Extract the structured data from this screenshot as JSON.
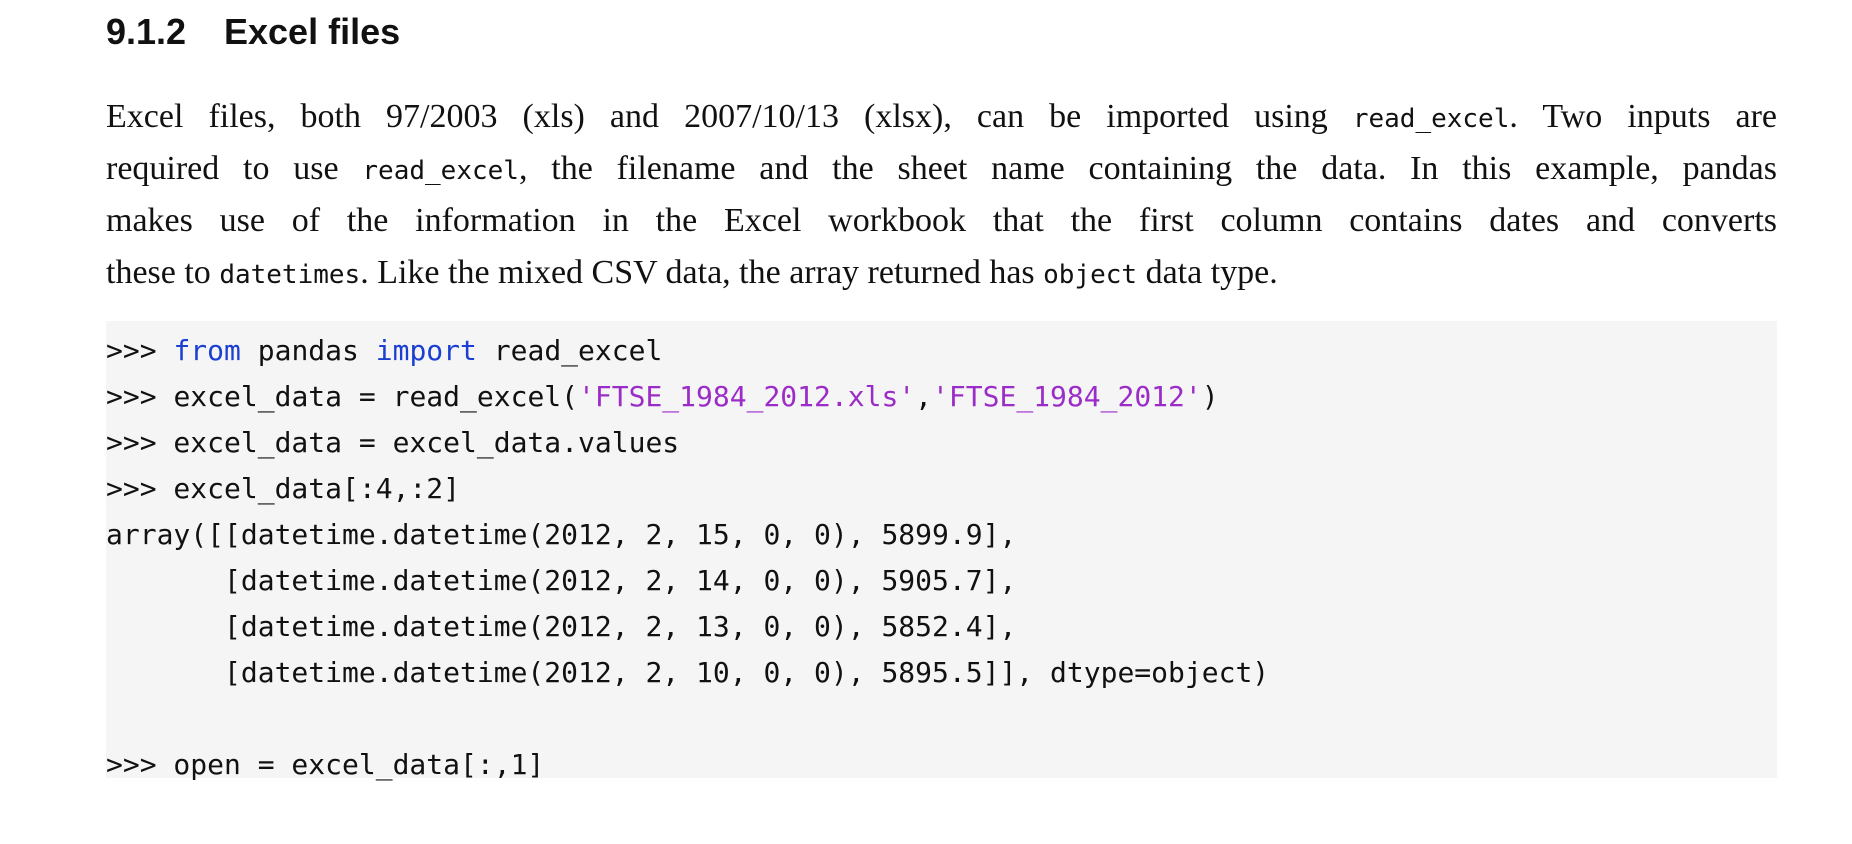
{
  "heading": {
    "number": "9.1.2",
    "title": "Excel files"
  },
  "paragraph": {
    "line1": {
      "text_a": "Excel files, both 97/2003 (xls) and 2007/10/13 (xlsx), can be imported using ",
      "code_a": "read_excel",
      "text_b": ". Two inputs are"
    },
    "line2": {
      "text_a": "required to use ",
      "code_a": "read_excel",
      "text_b": ", the filename and the sheet name containing the data. In this example, pandas"
    },
    "line3": {
      "text_a": "makes use of the information in the Excel workbook that the first column contains dates and converts"
    },
    "line4": {
      "text_a": "these to ",
      "code_a": "datetimes",
      "text_b": ". Like the mixed CSV data, the array returned has ",
      "code_b": "object",
      "text_c": " data type."
    }
  },
  "code": {
    "l1": {
      "prompt": ">>> ",
      "kw1": "from",
      "mid": " pandas ",
      "kw2": "import",
      "rest": " read_excel"
    },
    "l2": {
      "prompt": ">>> ",
      "pre": "excel_data = read_excel(",
      "str1": "'FTSE_1984_2012.xls'",
      "comma": ",",
      "str2": "'FTSE_1984_2012'",
      "post": ")"
    },
    "l3": {
      "text": ">>> excel_data = excel_data.values"
    },
    "l4": {
      "text": ">>> excel_data[:4,:2]"
    },
    "l5": {
      "text": "array([[datetime.datetime(2012, 2, 15, 0, 0), 5899.9],"
    },
    "l6": {
      "text": "       [datetime.datetime(2012, 2, 14, 0, 0), 5905.7],"
    },
    "l7": {
      "text": "       [datetime.datetime(2012, 2, 13, 0, 0), 5852.4],"
    },
    "l8": {
      "text": "       [datetime.datetime(2012, 2, 10, 0, 0), 5895.5]], dtype=object)"
    },
    "l9": {
      "text": ""
    },
    "l10": {
      "text": ">>> open = excel_data[:,1]"
    }
  },
  "colors": {
    "keyword": "#1a3fd1",
    "string": "#9b2cc8",
    "code_background": "#f5f5f5"
  }
}
